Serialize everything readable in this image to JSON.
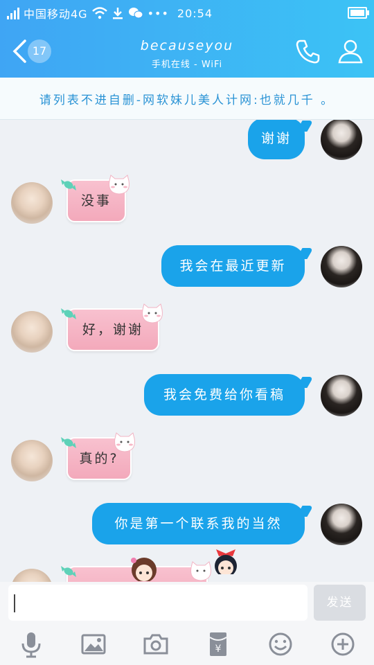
{
  "status": {
    "carrier": "中国移动4G",
    "extra_icons": "•••",
    "time": "20:54"
  },
  "header": {
    "unread_count": "17",
    "title": "becauseyou",
    "subtitle": "手机在线 - WiFi",
    "back_icon": "chevron-left-icon",
    "call_icon": "phone-icon",
    "profile_icon": "person-icon"
  },
  "notice": {
    "text": "请列表不进自删-网软妹儿美人计网:也就几千 。"
  },
  "messages": [
    {
      "side": "right",
      "text": "谢谢"
    },
    {
      "side": "left",
      "text": "没事"
    },
    {
      "side": "right",
      "text": "我会在最近更新"
    },
    {
      "side": "left",
      "text": "好，谢谢"
    },
    {
      "side": "right",
      "text": "我会免费给你看稿"
    },
    {
      "side": "left",
      "text": "真的?"
    },
    {
      "side": "right",
      "text": "你是第一个联系我的当然"
    }
  ],
  "composer": {
    "input_value": "",
    "send_label": "发送"
  },
  "toolbar": [
    "microphone-icon",
    "image-icon",
    "camera-icon",
    "red-packet-icon",
    "emoji-icon",
    "plus-icon"
  ],
  "colors": {
    "header": "#3fa5f4",
    "bubble_blue": "#1aa3ea",
    "bubble_pink": "#f8c1cf",
    "notice_text": "#2a93d5"
  }
}
